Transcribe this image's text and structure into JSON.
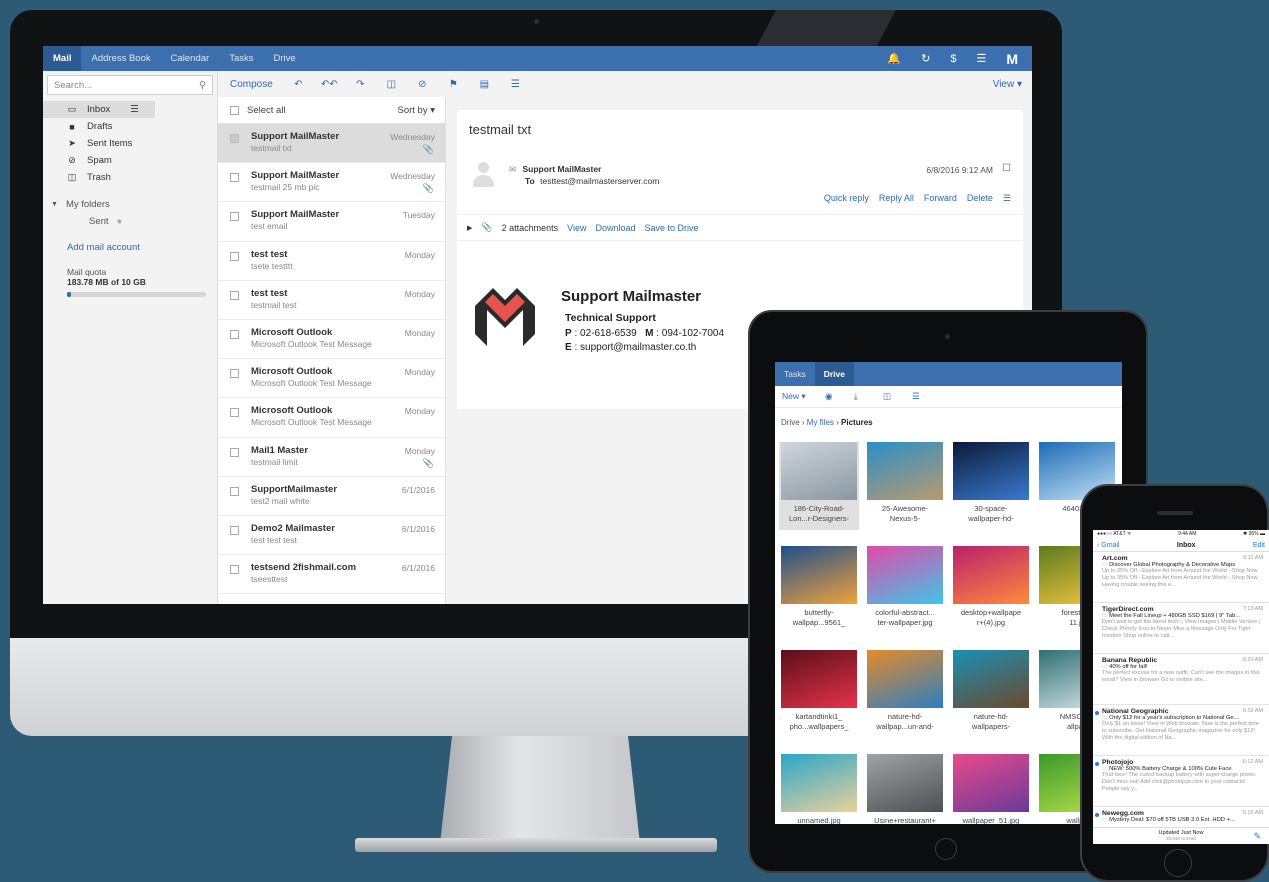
{
  "colors": {
    "accent": "#3c6fae",
    "link": "#2f6bb3",
    "bg": "#2d5a74"
  },
  "desktop": {
    "nav": {
      "tabs": [
        "Mail",
        "Address Book",
        "Calendar",
        "Tasks",
        "Drive"
      ],
      "icons": [
        "bell-icon",
        "sync-icon",
        "help-icon",
        "menu-icon",
        "mailmaster-logo"
      ]
    },
    "search": {
      "placeholder": "Search..."
    },
    "folders": [
      {
        "label": "Inbox",
        "icon": "inbox-icon"
      },
      {
        "label": "Drafts",
        "icon": "file-icon"
      },
      {
        "label": "Sent Items",
        "icon": "send-icon"
      },
      {
        "label": "Spam",
        "icon": "ban-icon"
      },
      {
        "label": "Trash",
        "icon": "trash-icon"
      }
    ],
    "my_folders": {
      "label": "My folders",
      "sub": "Sent"
    },
    "add_account": "Add mail account",
    "quota": {
      "label": "Mail quota",
      "value": "183.78 MB of 10 GB",
      "fraction": 0.018
    },
    "toolbar": {
      "compose": "Compose",
      "icons": [
        "reply-icon",
        "reply-all-icon",
        "forward-icon",
        "delete-icon",
        "spam-icon",
        "flag-icon",
        "archive-icon",
        "more-icon"
      ],
      "view": "View ▾"
    },
    "list": {
      "select_all": "Select all",
      "sort": "Sort by ▾",
      "messages": [
        {
          "from": "Support MailMaster",
          "subject": "testmail txt",
          "date": "Wednesday",
          "attach": true
        },
        {
          "from": "Support MailMaster",
          "subject": "testmail 25 mb pic",
          "date": "Wednesday",
          "attach": true
        },
        {
          "from": "Support MailMaster",
          "subject": "test email",
          "date": "Tuesday",
          "attach": false
        },
        {
          "from": "test test",
          "subject": "tsete testttt",
          "date": "Monday",
          "attach": false
        },
        {
          "from": "test test",
          "subject": "testmail test",
          "date": "Monday",
          "attach": false
        },
        {
          "from": "Microsoft Outlook",
          "subject": "Microsoft Outlook Test Message",
          "date": "Monday",
          "attach": false
        },
        {
          "from": "Microsoft Outlook",
          "subject": "Microsoft Outlook Test Message",
          "date": "Monday",
          "attach": false
        },
        {
          "from": "Microsoft Outlook",
          "subject": "Microsoft Outlook Test Message",
          "date": "Monday",
          "attach": false
        },
        {
          "from": "Mail1 Master",
          "subject": "testmail limit",
          "date": "Monday",
          "attach": true
        },
        {
          "from": "SupportMailmaster",
          "subject": "test2 mail white",
          "date": "6/1/2016",
          "attach": false
        },
        {
          "from": "Demo2 Mailmaster",
          "subject": "test test test",
          "date": "6/1/2016",
          "attach": false
        },
        {
          "from": "testsend 2fishmail.com",
          "subject": "tseesttest",
          "date": "6/1/2016",
          "attach": false
        }
      ]
    },
    "reading": {
      "subject": "testmail txt",
      "from": "Support MailMaster",
      "to_label": "To",
      "to": "testtest@mailmasterserver.com",
      "date": "6/8/2016 9:12 AM",
      "actions": [
        "Quick reply",
        "Reply All",
        "Forward",
        "Delete"
      ],
      "attachments": "2 attachments",
      "attach_links": [
        "View",
        "Download",
        "Save to Drive"
      ],
      "signature": {
        "name": "Support Mailmaster",
        "role": "Technical Support",
        "phone_label": "P",
        "phone": "02-618-6539",
        "mobile_label": "M",
        "mobile": "094-102-7004",
        "email_label": "E",
        "email": "support@mailmaster.co.th"
      }
    }
  },
  "tablet": {
    "nav": [
      "Tasks",
      "Drive"
    ],
    "toolbar": {
      "new": "New ▾",
      "icons": [
        "eye-icon",
        "download-icon",
        "delete-icon",
        "more-icon"
      ]
    },
    "crumbs": [
      "Drive",
      "My files",
      "Pictures"
    ],
    "files": [
      {
        "name1": "186-City-Road-",
        "name2": "Lon...r-Designers-",
        "c1": "#cfd6dc",
        "c2": "#8a97a1"
      },
      {
        "name1": "25-Awesome-",
        "name2": "Nexus-5-",
        "c1": "#2a8fc7",
        "c2": "#b89b6e"
      },
      {
        "name1": "30-space-",
        "name2": "wallpaper-hd-",
        "c1": "#0a1a3a",
        "c2": "#3a7ad1"
      },
      {
        "name1": "4640305",
        "name2": "",
        "c1": "#1f6bb5",
        "c2": "#bfe0f5"
      },
      {
        "name1": "butterfly-",
        "name2": "wallpap...9561_",
        "c1": "#1d4f8c",
        "c2": "#f2a23a"
      },
      {
        "name1": "colorful-abstract...",
        "name2": "ter-wallpaper.jpg",
        "c1": "#e24aa8",
        "c2": "#3ec6e8"
      },
      {
        "name1": "desktop+wallpape",
        "name2": "r+(4).jpg",
        "c1": "#b9206a",
        "c2": "#ff8a3c"
      },
      {
        "name1": "forest-wa",
        "name2": "11.jp",
        "c1": "#5d7a20",
        "c2": "#f6c940"
      },
      {
        "name1": "kartandtinki1_",
        "name2": "pho...wallpapers_",
        "c1": "#5a0e1a",
        "c2": "#e6334a"
      },
      {
        "name1": "nature-hd-",
        "name2": "wallpap...un-and-",
        "c1": "#e68a2a",
        "c2": "#2b7fc2"
      },
      {
        "name1": "nature-hd-",
        "name2": "wallpapers-",
        "c1": "#1b8fb5",
        "c2": "#6a4a2a"
      },
      {
        "name1": "NMSCond",
        "name2": "allpap",
        "c1": "#2f6f75",
        "c2": "#d9e8e8"
      },
      {
        "name1": "unnamed.jpg",
        "name2": "",
        "c1": "#2aa6c9",
        "c2": "#e9d29a"
      },
      {
        "name1": "Usine+restaurant+",
        "name2": "",
        "c1": "#9fa3a6",
        "c2": "#4c5053"
      },
      {
        "name1": "wallpaper_51.jpg",
        "name2": "",
        "c1": "#e84a8a",
        "c2": "#6a3a9a"
      },
      {
        "name1": "wallpa",
        "name2": "",
        "c1": "#3a9a2a",
        "c2": "#b7e04a"
      }
    ]
  },
  "phone": {
    "status": {
      "carrier": "●●●○○ AT&T ᯤ",
      "time": "9:44 AM",
      "battery": "✱ 95% ▬"
    },
    "nav": {
      "back": "Gmail",
      "title": "Inbox",
      "edit": "Edit"
    },
    "messages": [
      {
        "sender": "Art.com",
        "time": "6:11 AM",
        "subject": "Discover Global Photography & Decorative Maps",
        "preview": "Up to 35% Off - Explore Art from Around the World - Shop Now Up to 35% Off - Explore Art from Around the World - Shop Now Having trouble seeing this e...",
        "unread": false
      },
      {
        "sender": "TigerDirect.com",
        "time": "7:13 AM",
        "subject": "Meet the Fall Lineup + 480GB SSD $169 | 9\" Tab...",
        "preview": "Don't wait to get the latest tech! | View Images | Mobile Version | Check Priority Icon to Never Miss a Message Only For Tiger Insiders Shop online or call...",
        "unread": false
      },
      {
        "sender": "Banana Republic",
        "time": "6:20 AM",
        "subject": "40% off for fall!",
        "preview": "The perfect excuse for a new outfit. Can't see the images in this email? View in browser Go to mobile site...",
        "unread": false
      },
      {
        "sender": "National Geographic",
        "time": "6:19 AM",
        "subject": "Only $12 for a year's subscription to National Ge...",
        "preview": "Only $1 an issue! View in Web browser. Now is the perfect time to subscribe. Get National Geographic magazine for only $12! With the digital edition of Na...",
        "unread": true
      },
      {
        "sender": "Photojojo",
        "time": "6:12 AM",
        "subject": "NEW: 500% Battery Charge & 100% Cute Face",
        "preview": "That face! The cutest backup battery with super charge power. Don't miss out! Add click@photojojo.com to your contacts! People say y...",
        "unread": true
      },
      {
        "sender": "Newegg.com",
        "time": "5:15 AM",
        "subject": "Mystery Deal: $70 off 5TB USB 3.0 Ext. HDD +...",
        "preview": "",
        "unread": true
      }
    ],
    "footer": {
      "updated": "Updated Just Now",
      "unread": "20,836 Unread"
    }
  }
}
